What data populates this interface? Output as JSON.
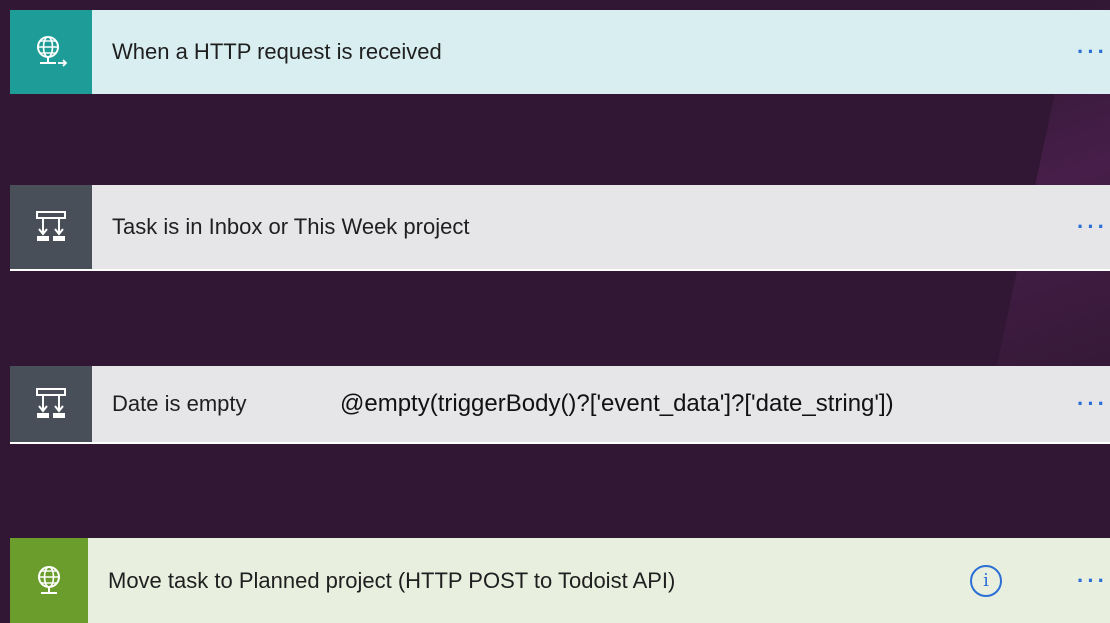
{
  "flow": {
    "steps": [
      {
        "id": "http-trigger",
        "title": "When a HTTP request is received",
        "icon": "globe-arrow-icon",
        "accent": "#1e9c97",
        "more_label": "···"
      },
      {
        "id": "condition-inbox",
        "title": "Task is in Inbox or This Week project",
        "icon": "condition-icon",
        "accent": "#484f58",
        "more_label": "···"
      },
      {
        "id": "condition-date",
        "title": "Date is empty",
        "expression": "@empty(triggerBody()?['event_data']?['date_string'])",
        "icon": "condition-icon",
        "accent": "#484f58",
        "more_label": "···"
      },
      {
        "id": "http-post",
        "title": "Move task to Planned project (HTTP POST to Todoist API)",
        "icon": "globe-icon",
        "accent": "#6b9d2d",
        "info_label": "i",
        "more_label": "···"
      }
    ]
  },
  "colors": {
    "background": "#311733",
    "more_dots": "#2b6fd6"
  }
}
